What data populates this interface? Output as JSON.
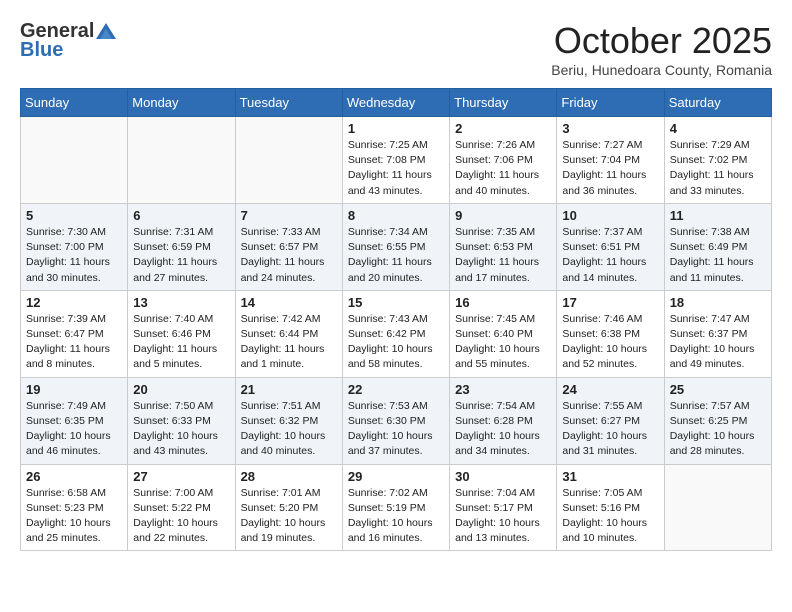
{
  "header": {
    "logo_general": "General",
    "logo_blue": "Blue",
    "month": "October 2025",
    "location": "Beriu, Hunedoara County, Romania"
  },
  "weekdays": [
    "Sunday",
    "Monday",
    "Tuesday",
    "Wednesday",
    "Thursday",
    "Friday",
    "Saturday"
  ],
  "rows": [
    {
      "shade": "white",
      "cells": [
        {
          "day": "",
          "info": ""
        },
        {
          "day": "",
          "info": ""
        },
        {
          "day": "",
          "info": ""
        },
        {
          "day": "1",
          "info": "Sunrise: 7:25 AM\nSunset: 7:08 PM\nDaylight: 11 hours\nand 43 minutes."
        },
        {
          "day": "2",
          "info": "Sunrise: 7:26 AM\nSunset: 7:06 PM\nDaylight: 11 hours\nand 40 minutes."
        },
        {
          "day": "3",
          "info": "Sunrise: 7:27 AM\nSunset: 7:04 PM\nDaylight: 11 hours\nand 36 minutes."
        },
        {
          "day": "4",
          "info": "Sunrise: 7:29 AM\nSunset: 7:02 PM\nDaylight: 11 hours\nand 33 minutes."
        }
      ]
    },
    {
      "shade": "shaded",
      "cells": [
        {
          "day": "5",
          "info": "Sunrise: 7:30 AM\nSunset: 7:00 PM\nDaylight: 11 hours\nand 30 minutes."
        },
        {
          "day": "6",
          "info": "Sunrise: 7:31 AM\nSunset: 6:59 PM\nDaylight: 11 hours\nand 27 minutes."
        },
        {
          "day": "7",
          "info": "Sunrise: 7:33 AM\nSunset: 6:57 PM\nDaylight: 11 hours\nand 24 minutes."
        },
        {
          "day": "8",
          "info": "Sunrise: 7:34 AM\nSunset: 6:55 PM\nDaylight: 11 hours\nand 20 minutes."
        },
        {
          "day": "9",
          "info": "Sunrise: 7:35 AM\nSunset: 6:53 PM\nDaylight: 11 hours\nand 17 minutes."
        },
        {
          "day": "10",
          "info": "Sunrise: 7:37 AM\nSunset: 6:51 PM\nDaylight: 11 hours\nand 14 minutes."
        },
        {
          "day": "11",
          "info": "Sunrise: 7:38 AM\nSunset: 6:49 PM\nDaylight: 11 hours\nand 11 minutes."
        }
      ]
    },
    {
      "shade": "white",
      "cells": [
        {
          "day": "12",
          "info": "Sunrise: 7:39 AM\nSunset: 6:47 PM\nDaylight: 11 hours\nand 8 minutes."
        },
        {
          "day": "13",
          "info": "Sunrise: 7:40 AM\nSunset: 6:46 PM\nDaylight: 11 hours\nand 5 minutes."
        },
        {
          "day": "14",
          "info": "Sunrise: 7:42 AM\nSunset: 6:44 PM\nDaylight: 11 hours\nand 1 minute."
        },
        {
          "day": "15",
          "info": "Sunrise: 7:43 AM\nSunset: 6:42 PM\nDaylight: 10 hours\nand 58 minutes."
        },
        {
          "day": "16",
          "info": "Sunrise: 7:45 AM\nSunset: 6:40 PM\nDaylight: 10 hours\nand 55 minutes."
        },
        {
          "day": "17",
          "info": "Sunrise: 7:46 AM\nSunset: 6:38 PM\nDaylight: 10 hours\nand 52 minutes."
        },
        {
          "day": "18",
          "info": "Sunrise: 7:47 AM\nSunset: 6:37 PM\nDaylight: 10 hours\nand 49 minutes."
        }
      ]
    },
    {
      "shade": "shaded",
      "cells": [
        {
          "day": "19",
          "info": "Sunrise: 7:49 AM\nSunset: 6:35 PM\nDaylight: 10 hours\nand 46 minutes."
        },
        {
          "day": "20",
          "info": "Sunrise: 7:50 AM\nSunset: 6:33 PM\nDaylight: 10 hours\nand 43 minutes."
        },
        {
          "day": "21",
          "info": "Sunrise: 7:51 AM\nSunset: 6:32 PM\nDaylight: 10 hours\nand 40 minutes."
        },
        {
          "day": "22",
          "info": "Sunrise: 7:53 AM\nSunset: 6:30 PM\nDaylight: 10 hours\nand 37 minutes."
        },
        {
          "day": "23",
          "info": "Sunrise: 7:54 AM\nSunset: 6:28 PM\nDaylight: 10 hours\nand 34 minutes."
        },
        {
          "day": "24",
          "info": "Sunrise: 7:55 AM\nSunset: 6:27 PM\nDaylight: 10 hours\nand 31 minutes."
        },
        {
          "day": "25",
          "info": "Sunrise: 7:57 AM\nSunset: 6:25 PM\nDaylight: 10 hours\nand 28 minutes."
        }
      ]
    },
    {
      "shade": "white",
      "cells": [
        {
          "day": "26",
          "info": "Sunrise: 6:58 AM\nSunset: 5:23 PM\nDaylight: 10 hours\nand 25 minutes."
        },
        {
          "day": "27",
          "info": "Sunrise: 7:00 AM\nSunset: 5:22 PM\nDaylight: 10 hours\nand 22 minutes."
        },
        {
          "day": "28",
          "info": "Sunrise: 7:01 AM\nSunset: 5:20 PM\nDaylight: 10 hours\nand 19 minutes."
        },
        {
          "day": "29",
          "info": "Sunrise: 7:02 AM\nSunset: 5:19 PM\nDaylight: 10 hours\nand 16 minutes."
        },
        {
          "day": "30",
          "info": "Sunrise: 7:04 AM\nSunset: 5:17 PM\nDaylight: 10 hours\nand 13 minutes."
        },
        {
          "day": "31",
          "info": "Sunrise: 7:05 AM\nSunset: 5:16 PM\nDaylight: 10 hours\nand 10 minutes."
        },
        {
          "day": "",
          "info": ""
        }
      ]
    }
  ]
}
